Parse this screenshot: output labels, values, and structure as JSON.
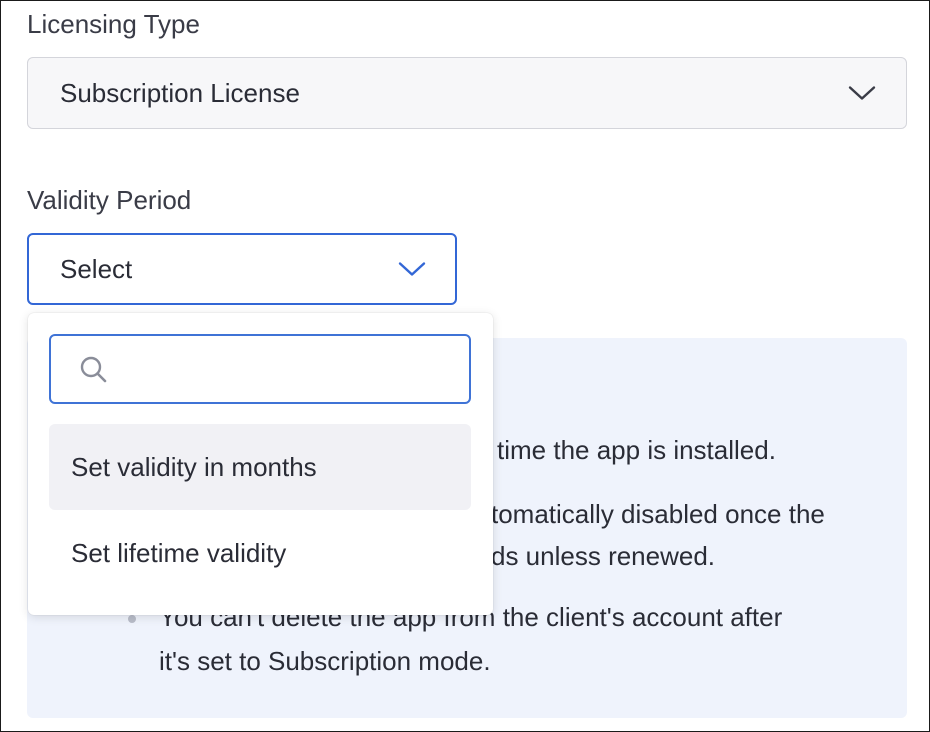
{
  "licensing": {
    "label": "Licensing Type",
    "selected": "Subscription License",
    "icon": "chevron-down-icon"
  },
  "validity": {
    "label": "Validity Period",
    "selected": "Select",
    "icon": "chevron-down-icon",
    "dropdown": {
      "search_placeholder": "",
      "search_icon": "search-icon",
      "options": [
        {
          "label": "Set validity in months",
          "highlighted": true
        },
        {
          "label": "Set lifetime validity",
          "highlighted": false
        }
      ]
    }
  },
  "info": {
    "line1": "time the app is installed.",
    "line2": "tomatically disabled once the",
    "line3": "ds unless renewed.",
    "line4": "You can't delete the app from the client's account after",
    "line5": "it's set to Subscription mode."
  },
  "colors": {
    "accent": "#3367d6",
    "info_background": "#eff3fc",
    "highlight_option": "#f1f1f5"
  }
}
